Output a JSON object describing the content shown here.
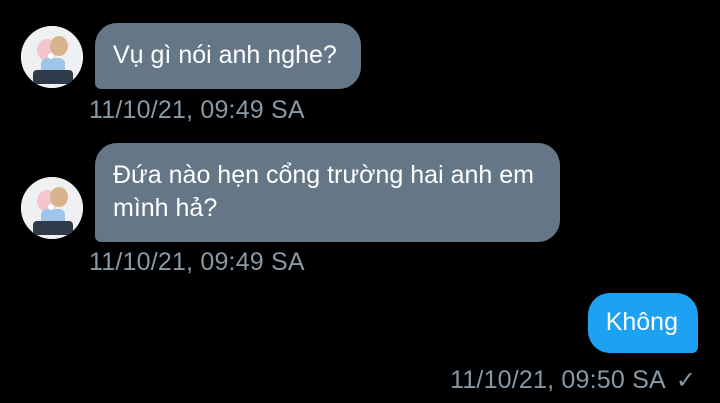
{
  "messages": [
    {
      "direction": "incoming",
      "text": "Vụ gì nói anh nghe?",
      "timestamp": "11/10/21, 09:49 SA"
    },
    {
      "direction": "incoming",
      "text": "Đứa nào hẹn cổng trường hai anh em mình hả?",
      "timestamp": "11/10/21, 09:49 SA"
    },
    {
      "direction": "outgoing",
      "text": "Không",
      "timestamp": "11/10/21, 09:50 SA",
      "status_icon": "check-icon"
    }
  ],
  "colors": {
    "background": "#000000",
    "incoming_bubble": "#657786",
    "outgoing_bubble": "#1da1f2",
    "timestamp": "#8899a6"
  }
}
